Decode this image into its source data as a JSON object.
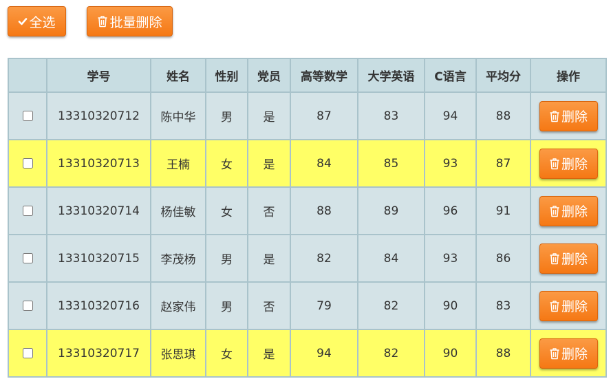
{
  "toolbar": {
    "select_all_label": "全选",
    "batch_delete_label": "批量删除"
  },
  "table": {
    "headers": {
      "student_id": "学号",
      "name": "姓名",
      "gender": "性别",
      "party_member": "党员",
      "math": "高等数学",
      "english": "大学英语",
      "c_lang": "C语言",
      "average": "平均分",
      "action": "操作"
    },
    "delete_label": "删除",
    "rows": [
      {
        "id": "13310320712",
        "name": "陈中华",
        "gender": "男",
        "party": "是",
        "math": "87",
        "english": "83",
        "c": "94",
        "avg": "88",
        "highlight": false
      },
      {
        "id": "13310320713",
        "name": "王楠",
        "gender": "女",
        "party": "是",
        "math": "84",
        "english": "85",
        "c": "93",
        "avg": "87",
        "highlight": true
      },
      {
        "id": "13310320714",
        "name": "杨佳敏",
        "gender": "女",
        "party": "否",
        "math": "88",
        "english": "89",
        "c": "96",
        "avg": "91",
        "highlight": false
      },
      {
        "id": "13310320715",
        "name": "李茂杨",
        "gender": "男",
        "party": "是",
        "math": "82",
        "english": "84",
        "c": "93",
        "avg": "86",
        "highlight": false
      },
      {
        "id": "13310320716",
        "name": "赵家伟",
        "gender": "男",
        "party": "否",
        "math": "79",
        "english": "82",
        "c": "90",
        "avg": "83",
        "highlight": false
      },
      {
        "id": "13310320717",
        "name": "张思琪",
        "gender": "女",
        "party": "是",
        "math": "94",
        "english": "82",
        "c": "90",
        "avg": "88",
        "highlight": true
      }
    ]
  },
  "colors": {
    "button_orange": "#f68a2a",
    "header_bg": "#c8dde2",
    "row_bg": "#d4e3e7",
    "highlight_bg": "#ffff66",
    "border": "#a9c3cb"
  },
  "icons": {
    "select_all": "check-icon",
    "delete": "trash-icon"
  }
}
